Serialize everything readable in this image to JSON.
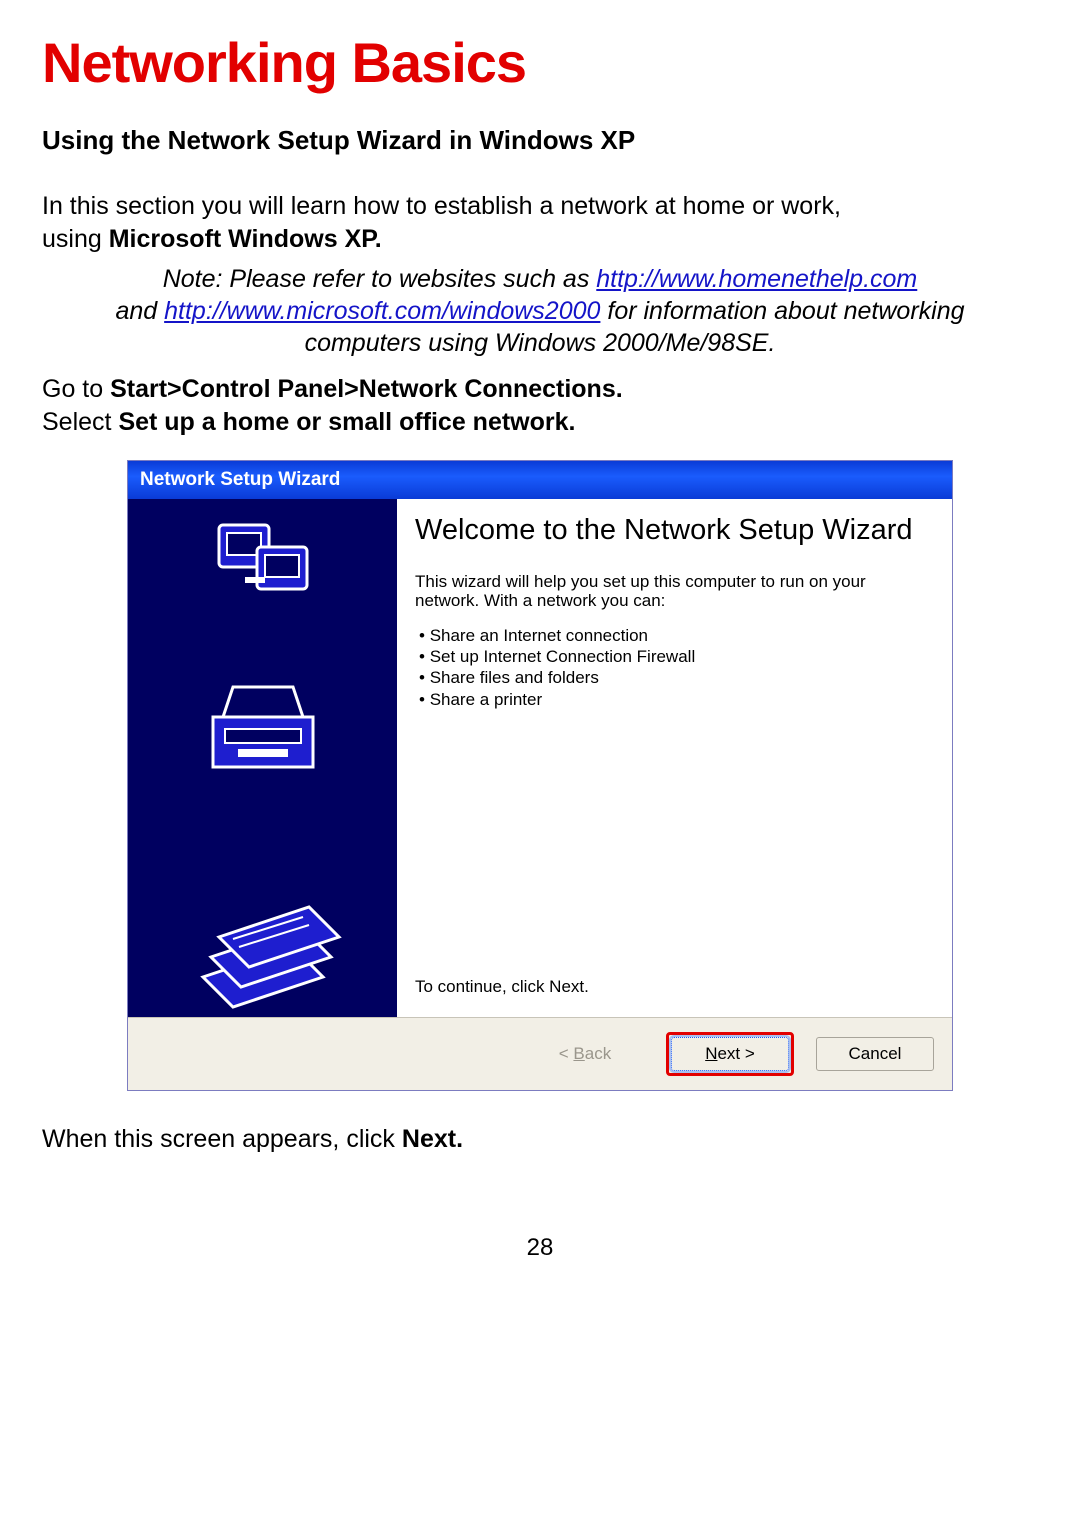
{
  "doc": {
    "title": "Networking Basics",
    "subtitle": "Using the Network Setup Wizard in Windows XP",
    "intro1": "In this section you will learn how to establish a network at home or work,",
    "intro2a": "using ",
    "intro2b": "Microsoft Windows XP.",
    "note_lead": "Note:  Please refer to websites such as ",
    "note_link1": "http://www.homenethelp.com",
    "note_mid1": "and ",
    "note_link2": "http://www.microsoft.com/windows2000",
    "note_mid2": "  for information about networking",
    "note_tail": "computers using Windows 2000/Me/98SE.",
    "instr1a": "Go to ",
    "instr1b": "Start>Control Panel>Network Connections.",
    "instr2a": "Select ",
    "instr2b": "Set up a home or small office network.",
    "after1": "When this screen appears, click ",
    "after2": "Next.",
    "page_number": "28"
  },
  "wizard": {
    "titlebar": "Network Setup Wizard",
    "heading": "Welcome to the Network Setup Wizard",
    "lead": "This wizard will help you set up this computer to run on your network. With a network you can:",
    "bullets": [
      "Share an Internet connection",
      "Set up Internet Connection Firewall",
      "Share files and folders",
      "Share a printer"
    ],
    "continue": "To continue, click Next.",
    "buttons": {
      "back": "< Back",
      "next": "Next >",
      "cancel": "Cancel"
    }
  }
}
